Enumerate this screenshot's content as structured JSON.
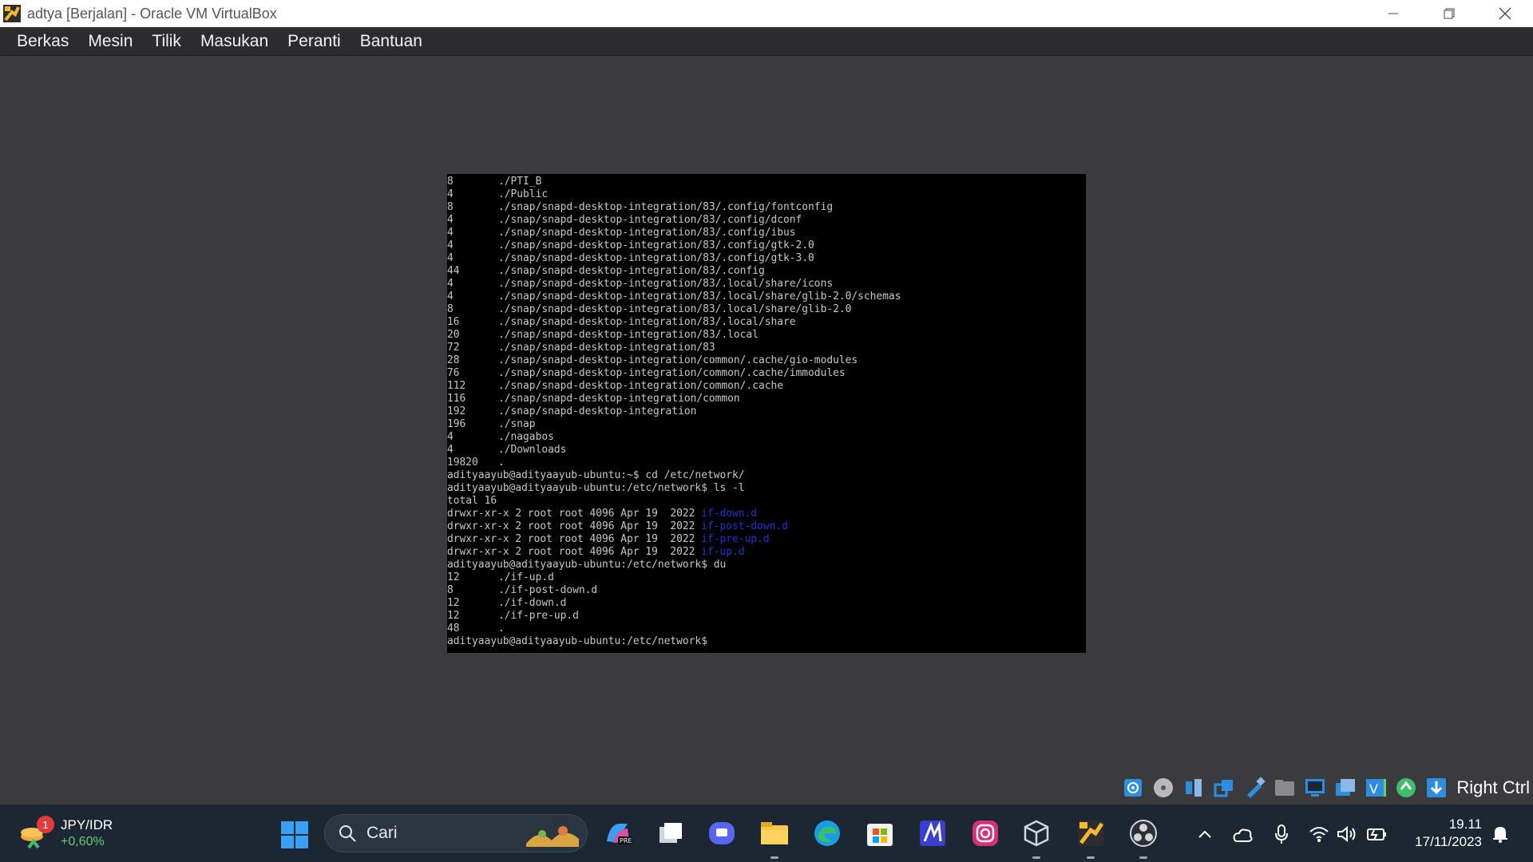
{
  "window": {
    "title": "adtya [Berjalan] - Oracle VM VirtualBox",
    "controls": [
      "minimize-icon",
      "restore-icon",
      "close-icon"
    ]
  },
  "menu": {
    "items": [
      "Berkas",
      "Mesin",
      "Tilik",
      "Masukan",
      "Peranti",
      "Bantuan"
    ]
  },
  "terminal": {
    "du_home": [
      {
        "size": "8",
        "path": "./PTI_B"
      },
      {
        "size": "4",
        "path": "./Public"
      },
      {
        "size": "8",
        "path": "./snap/snapd-desktop-integration/83/.config/fontconfig"
      },
      {
        "size": "4",
        "path": "./snap/snapd-desktop-integration/83/.config/dconf"
      },
      {
        "size": "4",
        "path": "./snap/snapd-desktop-integration/83/.config/ibus"
      },
      {
        "size": "4",
        "path": "./snap/snapd-desktop-integration/83/.config/gtk-2.0"
      },
      {
        "size": "4",
        "path": "./snap/snapd-desktop-integration/83/.config/gtk-3.0"
      },
      {
        "size": "44",
        "path": "./snap/snapd-desktop-integration/83/.config"
      },
      {
        "size": "4",
        "path": "./snap/snapd-desktop-integration/83/.local/share/icons"
      },
      {
        "size": "4",
        "path": "./snap/snapd-desktop-integration/83/.local/share/glib-2.0/schemas"
      },
      {
        "size": "8",
        "path": "./snap/snapd-desktop-integration/83/.local/share/glib-2.0"
      },
      {
        "size": "16",
        "path": "./snap/snapd-desktop-integration/83/.local/share"
      },
      {
        "size": "20",
        "path": "./snap/snapd-desktop-integration/83/.local"
      },
      {
        "size": "72",
        "path": "./snap/snapd-desktop-integration/83"
      },
      {
        "size": "28",
        "path": "./snap/snapd-desktop-integration/common/.cache/gio-modules"
      },
      {
        "size": "76",
        "path": "./snap/snapd-desktop-integration/common/.cache/immodules"
      },
      {
        "size": "112",
        "path": "./snap/snapd-desktop-integration/common/.cache"
      },
      {
        "size": "116",
        "path": "./snap/snapd-desktop-integration/common"
      },
      {
        "size": "192",
        "path": "./snap/snapd-desktop-integration"
      },
      {
        "size": "196",
        "path": "./snap"
      },
      {
        "size": "4",
        "path": "./nagabos"
      },
      {
        "size": "4",
        "path": "./Downloads"
      },
      {
        "size": "19820",
        "path": "."
      }
    ],
    "cmd_cd": "adityaayub@adityaayub-ubuntu:~$ cd /etc/network/",
    "cmd_ls": "adityaayub@adityaayub-ubuntu:/etc/network$ ls -l",
    "ls_total": "total 16",
    "ls_rows": [
      {
        "meta": "drwxr-xr-x 2 root root 4096 Apr 19  2022 ",
        "name": "if-down.d"
      },
      {
        "meta": "drwxr-xr-x 2 root root 4096 Apr 19  2022 ",
        "name": "if-post-down.d"
      },
      {
        "meta": "drwxr-xr-x 2 root root 4096 Apr 19  2022 ",
        "name": "if-pre-up.d"
      },
      {
        "meta": "drwxr-xr-x 2 root root 4096 Apr 19  2022 ",
        "name": "if-up.d"
      }
    ],
    "cmd_du": "adityaayub@adityaayub-ubuntu:/etc/network$ du",
    "du_network": [
      {
        "size": "12",
        "path": "./if-up.d"
      },
      {
        "size": "8",
        "path": "./if-post-down.d"
      },
      {
        "size": "12",
        "path": "./if-down.d"
      },
      {
        "size": "12",
        "path": "./if-pre-up.d"
      },
      {
        "size": "48",
        "path": "."
      }
    ],
    "prompt_final": "adityaayub@adityaayub-ubuntu:/etc/network$"
  },
  "statusbar": {
    "icons": [
      "hard-disk-icon",
      "optical-drive-icon",
      "audio-icon",
      "network-icon",
      "usb-icon",
      "shared-folder-icon",
      "display-icon",
      "recording-icon",
      "vt-x-icon",
      "mouse-integration-icon",
      "keyboard-capture-icon"
    ],
    "host_key": "Right Ctrl"
  },
  "taskbar": {
    "widget": {
      "badge": "1",
      "title": "JPY/IDR",
      "value": "+0,60%"
    },
    "search_placeholder": "Cari",
    "apps": [
      "copilot-icon",
      "task-view-icon",
      "discord-icon",
      "file-explorer-icon",
      "edge-icon",
      "microsoft-store-icon",
      "maestro-icon",
      "instagram-icon",
      "virtualbox-icon",
      "virtualbox-vm-icon",
      "obs-icon"
    ],
    "tray": [
      "show-hidden-icons-chevron",
      "onedrive-icon",
      "microphone-icon",
      "wifi-icon",
      "volume-icon",
      "battery-icon"
    ],
    "time": "19.11",
    "date": "17/11/2023"
  },
  "colors": {
    "terminal_bg": "#000000",
    "terminal_text": "#c8c8c8",
    "dir_color": "#2432c8",
    "menubar_bg": "#2c2c2e",
    "vm_bg": "#3b3b3e",
    "taskbar_bg": "#1c2733"
  }
}
